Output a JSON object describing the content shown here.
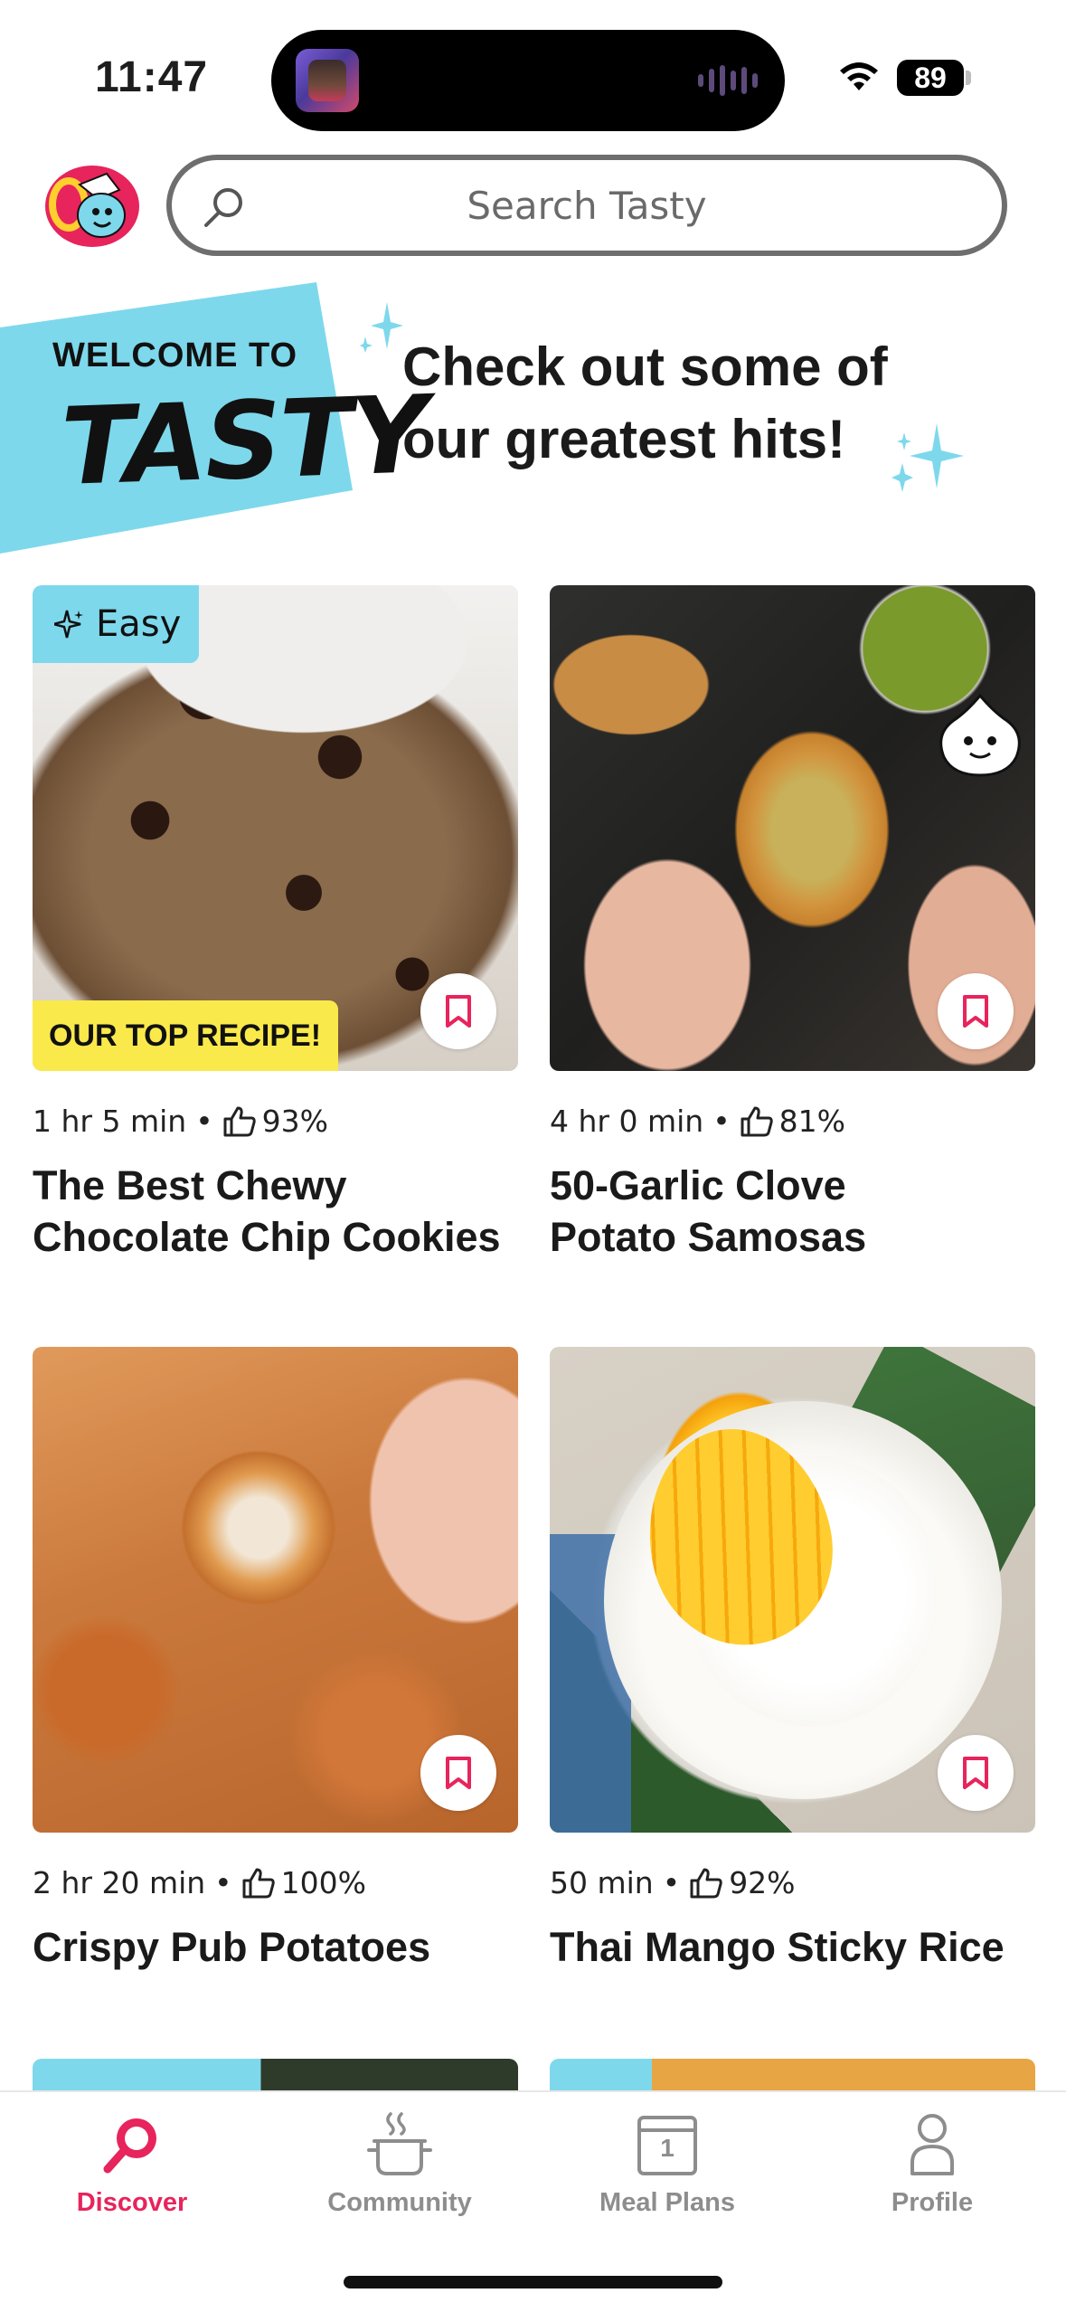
{
  "status_bar": {
    "time": "11:47",
    "battery": "89",
    "icons": [
      "wifi-icon",
      "battery-icon",
      "audio-waveform-icon"
    ]
  },
  "header": {
    "logo_icon": "tasty-mascot-logo",
    "search_placeholder": "Search Tasty",
    "search_icon": "search-icon"
  },
  "welcome": {
    "small_text": "WELCOME TO",
    "big_text": "TASTY",
    "headline_line1": "Check out some of",
    "headline_line2": "our greatest hits!",
    "accent_color": "#7ed8ec"
  },
  "recipes": [
    {
      "time": "1 hr 5 min",
      "rating": "93%",
      "title_line1": "The Best Chewy",
      "title_line2": "Chocolate Chip Cookies",
      "badge_top_left": "Easy",
      "badge_bottom": "OUR TOP RECIPE!"
    },
    {
      "time": "4 hr 0 min",
      "rating": "81%",
      "title_line1": "50-Garlic Clove",
      "title_line2": "Potato Samosas"
    },
    {
      "time": "2 hr 20 min",
      "rating": "100%",
      "title_line1": "Crispy Pub Potatoes",
      "title_line2": ""
    },
    {
      "time": "50 min",
      "rating": "92%",
      "title_line1": "Thai Mango Sticky Rice",
      "title_line2": ""
    }
  ],
  "bottom_nav": {
    "items": [
      {
        "label": "Discover",
        "icon": "discover-whisk-icon",
        "active": true
      },
      {
        "label": "Community",
        "icon": "community-pot-icon",
        "active": false
      },
      {
        "label": "Meal Plans",
        "icon": "calendar-icon",
        "active": false
      },
      {
        "label": "Profile",
        "icon": "profile-icon",
        "active": false
      }
    ],
    "calendar_day": "1",
    "active_color": "#e7245c"
  }
}
